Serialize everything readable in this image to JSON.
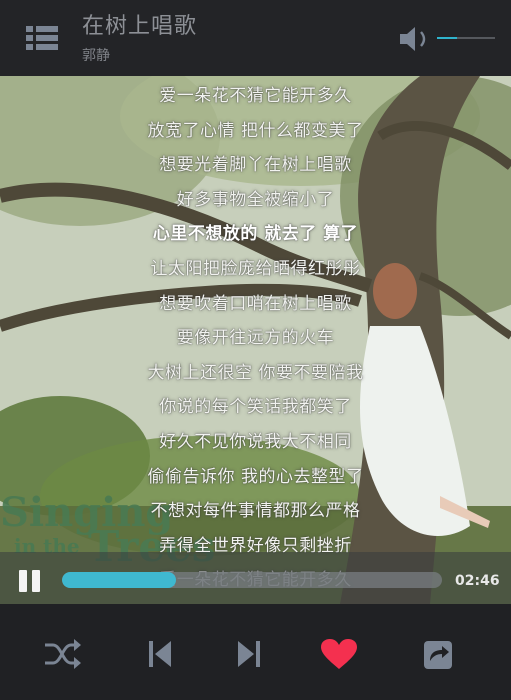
{
  "header": {
    "title": "在树上唱歌",
    "artist": "郭静",
    "volume_level": 0.35
  },
  "album_art": {
    "cover_text": "Singing in the Trees"
  },
  "lyrics": [
    "爱一朵花不猜它能开多久",
    "放宽了心情 把什么都变美了",
    "想要光着脚丫在树上唱歌",
    "好多事物全被缩小了",
    "心里不想放的 就去了 算了",
    "让太阳把脸庞给晒得红彤彤",
    "想要吹着口哨在树上唱歌",
    "要像开往远方的火车",
    "大树上还很空 你要不要陪我",
    "你说的每个笑话我都笑了",
    "好久不见你说我大不相同",
    "偷偷告诉你 我的心去整型了",
    "不想对每件事情都那么严格",
    "弄得全世界好像只剩挫折",
    "爱一朵花不猜它能开多久"
  ],
  "active_lyric_index": 4,
  "playback": {
    "state": "playing",
    "progress": 0.3,
    "time_label": "02:46"
  },
  "colors": {
    "accent": "#3fb8d0",
    "heart": "#f4304f",
    "control_icon": "#7b8594"
  },
  "controls": [
    {
      "name": "shuffle-icon"
    },
    {
      "name": "previous-icon"
    },
    {
      "name": "next-icon"
    },
    {
      "name": "heart-icon"
    },
    {
      "name": "share-icon"
    }
  ]
}
